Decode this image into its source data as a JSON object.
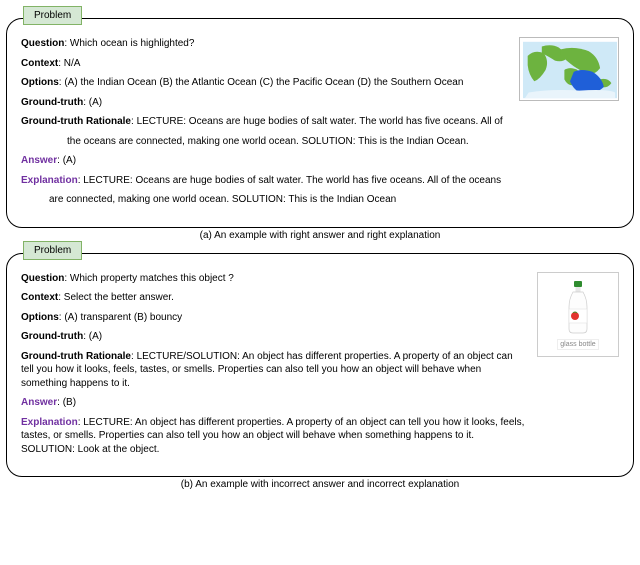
{
  "problem_tag": "Problem",
  "labels": {
    "question": "Question",
    "context": "Context",
    "options": "Options",
    "gt": "Ground-truth",
    "gtr": "Ground-truth Rationale",
    "answer": "Answer",
    "explanation": "Explanation"
  },
  "cards": [
    {
      "question": "Which ocean is highlighted?",
      "context": "N/A",
      "options": "(A) the Indian Ocean (B) the Atlantic Ocean (C) the Pacific Ocean (D) the Southern Ocean",
      "gt": "(A)",
      "gtr_line1": "LECTURE: Oceans are huge bodies of salt water. The world has five oceans. All of",
      "gtr_line2": "the oceans are connected, making one world ocean. SOLUTION: This is the Indian Ocean.",
      "answer": "(A)",
      "exp_line1": "LECTURE: Oceans are huge bodies of salt water. The world has five oceans. All of the oceans",
      "exp_line2": "are connected, making one world ocean. SOLUTION: This is the Indian Ocean",
      "caption": "(a) An example with right answer and right explanation"
    },
    {
      "question": "Which property matches this object ?",
      "context": "Select the better answer.",
      "options": "(A) transparent (B) bouncy",
      "gt": "(A)",
      "gtr_full": "LECTURE/SOLUTION: An object has different properties. A property of an object can tell you how it looks, feels, tastes, or smells. Properties can also tell you how an object will behave when something happens to it.",
      "answer": "(B)",
      "exp_full": "LECTURE: An object has different properties. A property of an object can tell you how it looks, feels, tastes, or smells. Properties can also tell you how an object will behave when something happens to it. SOLUTION: Look at the object.",
      "bottle_label": "glass bottle",
      "caption": "(b) An example with incorrect answer and incorrect explanation"
    }
  ]
}
